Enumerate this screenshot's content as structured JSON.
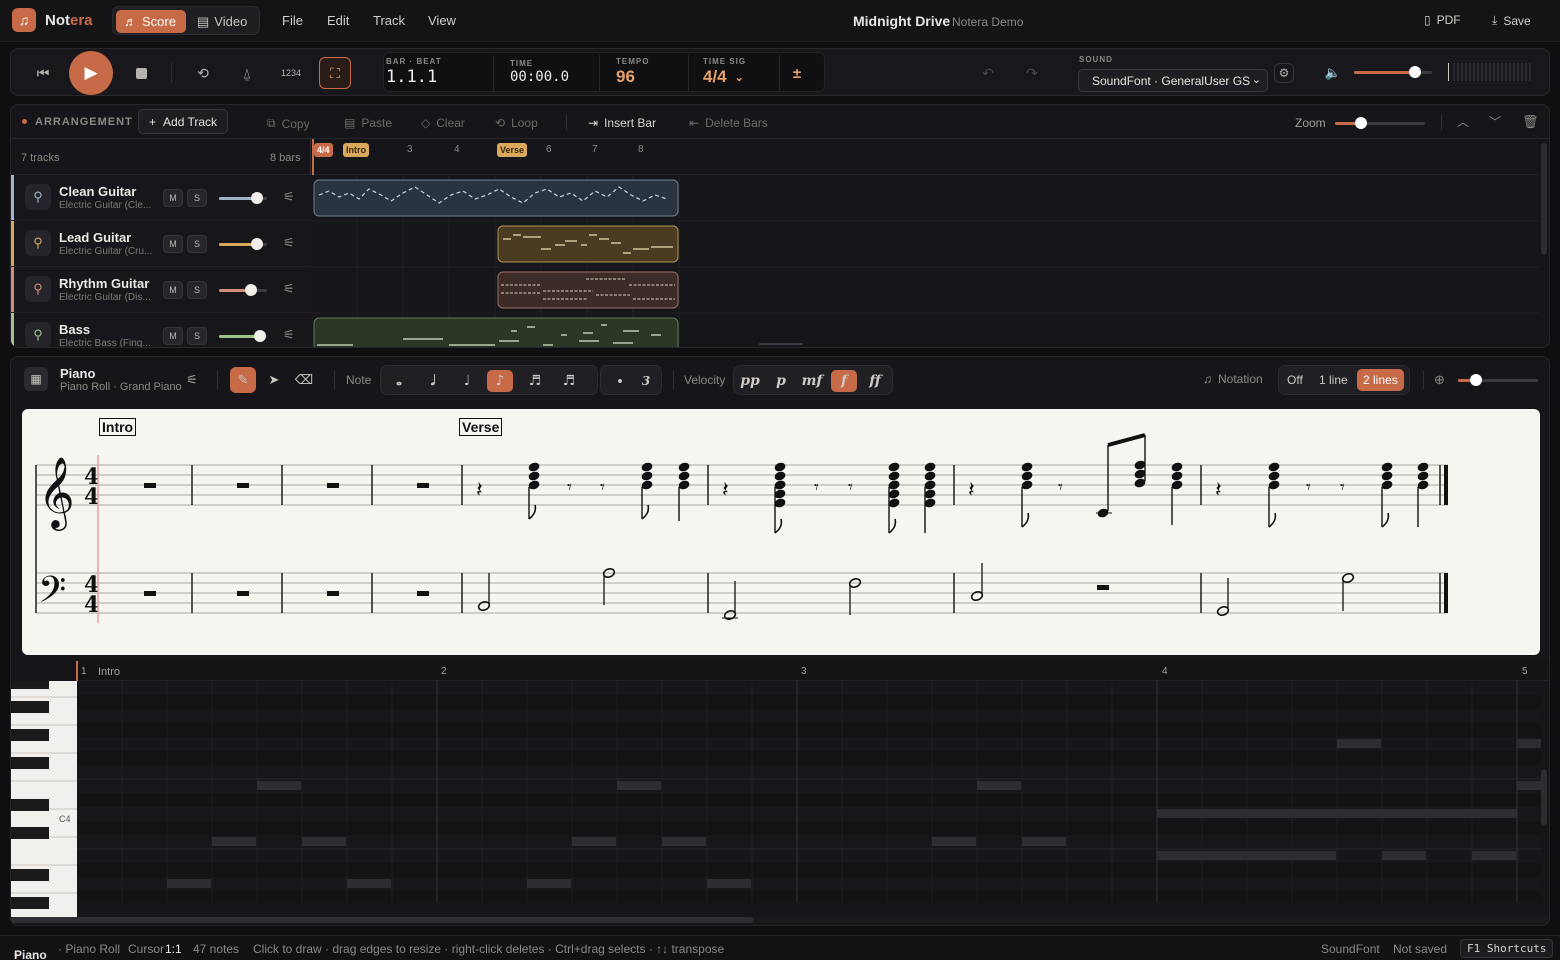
{
  "app": {
    "name_a": "Not",
    "name_b": "era",
    "logo_icon": "music-note-icon"
  },
  "modes": {
    "score": "Score",
    "video": "Video"
  },
  "menu": {
    "file": "File",
    "edit": "Edit",
    "track": "Track",
    "view": "View"
  },
  "doc": {
    "title": "Midnight Drive",
    "subtitle": "Notera Demo"
  },
  "topright": {
    "pdf": "PDF",
    "save": "Save"
  },
  "transport": {
    "count_in": "1234",
    "bar_beat_label": "BAR · BEAT",
    "bar_beat": "1.1.1",
    "time_label": "TIME",
    "time": "00:00.0",
    "tempo_label": "TEMPO",
    "tempo": "96",
    "timesig_label": "TIME SIG",
    "timesig": "4/4",
    "plusminus": "±",
    "sound_label": "SOUND",
    "sound": "SoundFont · GeneralUser GS",
    "volume": 0.78
  },
  "arrangement": {
    "title": "ARRANGEMENT",
    "add_track": "Add Track",
    "copy": "Copy",
    "paste": "Paste",
    "clear": "Clear",
    "loop": "Loop",
    "insert_bar": "Insert Bar",
    "delete_bars": "Delete Bars",
    "zoom": "Zoom",
    "track_count": "7 tracks",
    "bar_count": "8 bars",
    "ruler": {
      "timesig": "4/4",
      "intro": "Intro",
      "verse": "Verse",
      "n3": "3",
      "n4": "4",
      "n6": "6",
      "n7": "7",
      "n8": "8"
    },
    "tracks": [
      {
        "name": "Clean Guitar",
        "inst": "Electric Guitar (Cle...",
        "color": "#9fb3c8",
        "volume": 0.8
      },
      {
        "name": "Lead Guitar",
        "inst": "Electric Guitar (Cru...",
        "color": "#d9a85a",
        "volume": 0.8
      },
      {
        "name": "Rhythm Guitar",
        "inst": "Electric Guitar (Dis...",
        "color": "#d48f7a",
        "volume": 0.67
      },
      {
        "name": "Bass",
        "inst": "Electric Bass (Fing...",
        "color": "#9fc28a",
        "volume": 0.85
      }
    ],
    "m": "M",
    "s": "S"
  },
  "editor": {
    "name": "Piano",
    "sub": "Piano Roll · Grand Piano",
    "note_label": "Note",
    "triplet": "3",
    "dot": "•",
    "velocity_label": "Velocity",
    "velocities": [
      "pp",
      "p",
      "mf",
      "f",
      "ff"
    ],
    "notation_label": "Notation",
    "off": "Off",
    "one_line": "1 line",
    "two_lines": "2 lines"
  },
  "score": {
    "intro": "Intro",
    "verse": "Verse"
  },
  "roll": {
    "bar1": "1",
    "intro": "Intro",
    "bar2": "2",
    "bar3": "3",
    "bar4": "4",
    "bar5": "5",
    "c4": "C4"
  },
  "status": {
    "track": "Piano",
    "mode": "· Piano Roll",
    "cursor_label": "Cursor",
    "cursor": "1:1",
    "notes": "47 notes",
    "hint": "Click to draw · drag edges to resize · right-click deletes · Ctrl+drag selects · ↑↓ transpose",
    "engine": "SoundFont",
    "saved": "Not saved",
    "shortcuts": "F1 Shortcuts"
  }
}
